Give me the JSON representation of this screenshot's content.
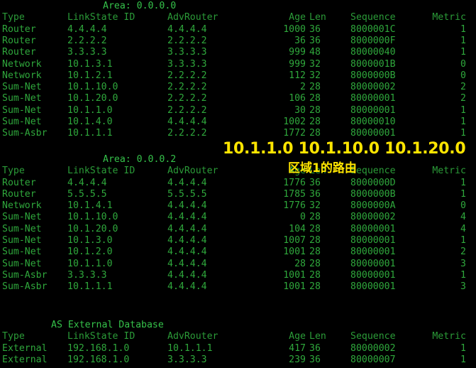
{
  "terminal": {
    "background": "#000000",
    "text_color": "#2fa83c",
    "header_color": "#2b9b38",
    "annotation_color": "#FFE500"
  },
  "columns": [
    "Type",
    "LinkState ID",
    "AdvRouter",
    "Age",
    "Len",
    "Sequence",
    "Metric"
  ],
  "sections": [
    {
      "title": "Area: 0.0.0.0",
      "rows": [
        {
          "type": "Router",
          "lsid": "4.4.4.4",
          "adv": "4.4.4.4",
          "age": "1000",
          "len": "36",
          "seq": "8000001C",
          "metric": "1"
        },
        {
          "type": "Router",
          "lsid": "2.2.2.2",
          "adv": "2.2.2.2",
          "age": "36",
          "len": "36",
          "seq": "8000000F",
          "metric": "1"
        },
        {
          "type": "Router",
          "lsid": "3.3.3.3",
          "adv": "3.3.3.3",
          "age": "999",
          "len": "48",
          "seq": "80000040",
          "metric": "1"
        },
        {
          "type": "Network",
          "lsid": "10.1.3.1",
          "adv": "3.3.3.3",
          "age": "999",
          "len": "32",
          "seq": "8000001B",
          "metric": "0"
        },
        {
          "type": "Network",
          "lsid": "10.1.2.1",
          "adv": "2.2.2.2",
          "age": "112",
          "len": "32",
          "seq": "8000000B",
          "metric": "0"
        },
        {
          "type": "Sum-Net",
          "lsid": "10.1.10.0",
          "adv": "2.2.2.2",
          "age": "2",
          "len": "28",
          "seq": "80000002",
          "metric": "2"
        },
        {
          "type": "Sum-Net",
          "lsid": "10.1.20.0",
          "adv": "2.2.2.2",
          "age": "106",
          "len": "28",
          "seq": "80000001",
          "metric": "2"
        },
        {
          "type": "Sum-Net",
          "lsid": "10.1.1.0",
          "adv": "2.2.2.2",
          "age": "30",
          "len": "28",
          "seq": "80000001",
          "metric": "1"
        },
        {
          "type": "Sum-Net",
          "lsid": "10.1.4.0",
          "adv": "4.4.4.4",
          "age": "1002",
          "len": "28",
          "seq": "80000010",
          "metric": "1"
        },
        {
          "type": "Sum-Asbr",
          "lsid": "10.1.1.1",
          "adv": "2.2.2.2",
          "age": "1772",
          "len": "28",
          "seq": "80000001",
          "metric": "1"
        }
      ]
    },
    {
      "title": "Area: 0.0.0.2",
      "rows": [
        {
          "type": "Router",
          "lsid": "4.4.4.4",
          "adv": "4.4.4.4",
          "age": "1776",
          "len": "36",
          "seq": "8000000D",
          "metric": "1"
        },
        {
          "type": "Router",
          "lsid": "5.5.5.5",
          "adv": "5.5.5.5",
          "age": "1785",
          "len": "36",
          "seq": "8000000B",
          "metric": "1"
        },
        {
          "type": "Network",
          "lsid": "10.1.4.1",
          "adv": "4.4.4.4",
          "age": "1776",
          "len": "32",
          "seq": "8000000A",
          "metric": "0"
        },
        {
          "type": "Sum-Net",
          "lsid": "10.1.10.0",
          "adv": "4.4.4.4",
          "age": "0",
          "len": "28",
          "seq": "80000002",
          "metric": "4"
        },
        {
          "type": "Sum-Net",
          "lsid": "10.1.20.0",
          "adv": "4.4.4.4",
          "age": "104",
          "len": "28",
          "seq": "80000001",
          "metric": "4"
        },
        {
          "type": "Sum-Net",
          "lsid": "10.1.3.0",
          "adv": "4.4.4.4",
          "age": "1007",
          "len": "28",
          "seq": "80000001",
          "metric": "1"
        },
        {
          "type": "Sum-Net",
          "lsid": "10.1.2.0",
          "adv": "4.4.4.4",
          "age": "1001",
          "len": "28",
          "seq": "80000001",
          "metric": "2"
        },
        {
          "type": "Sum-Net",
          "lsid": "10.1.1.0",
          "adv": "4.4.4.4",
          "age": "28",
          "len": "28",
          "seq": "80000001",
          "metric": "3"
        },
        {
          "type": "Sum-Asbr",
          "lsid": "3.3.3.3",
          "adv": "4.4.4.4",
          "age": "1001",
          "len": "28",
          "seq": "80000001",
          "metric": "1"
        },
        {
          "type": "Sum-Asbr",
          "lsid": "10.1.1.1",
          "adv": "4.4.4.4",
          "age": "1001",
          "len": "28",
          "seq": "80000001",
          "metric": "3"
        }
      ]
    },
    {
      "title": "AS External Database",
      "rows": [
        {
          "type": "External",
          "lsid": "192.168.1.0",
          "adv": "10.1.1.1",
          "age": "417",
          "len": "36",
          "seq": "80000002",
          "metric": "1"
        },
        {
          "type": "External",
          "lsid": "192.168.1.0",
          "adv": "3.3.3.3",
          "age": "239",
          "len": "36",
          "seq": "80000007",
          "metric": "1"
        }
      ]
    }
  ],
  "annotations": {
    "prefixes": "10.1.1.0 10.1.10.0 10.1.20.0",
    "caption": "区域1的路由"
  }
}
